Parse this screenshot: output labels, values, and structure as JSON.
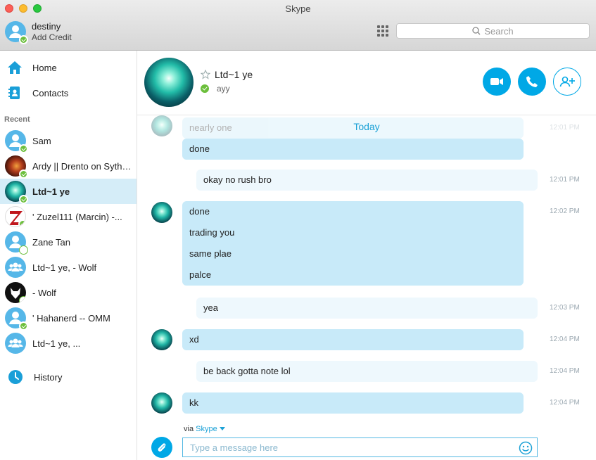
{
  "window": {
    "title": "Skype"
  },
  "profile": {
    "name": "destiny",
    "credit_label": "Add Credit"
  },
  "search": {
    "placeholder": "Search"
  },
  "nav": {
    "home": "Home",
    "contacts": "Contacts",
    "recent_heading": "Recent",
    "history": "History"
  },
  "contacts": [
    {
      "name": "Sam",
      "avatar": "default",
      "status": "online",
      "icon": "person-icon"
    },
    {
      "name": "Ardy || Drento on Sythe ||",
      "avatar": "photo-fire",
      "status": "online",
      "icon": "photo"
    },
    {
      "name": "Ltd~1 ye",
      "avatar": "photo-aurora",
      "status": "online",
      "icon": "photo",
      "active": true
    },
    {
      "name": "' Zuzel111 (Marcin) -...",
      "avatar": "photo-z",
      "status": "online",
      "icon": "photo"
    },
    {
      "name": "Zane Tan",
      "avatar": "default",
      "status": "away",
      "icon": "person-icon"
    },
    {
      "name": "Ltd~1 ye, - Wolf",
      "avatar": "group",
      "status": "none",
      "icon": "group-icon"
    },
    {
      "name": "- Wolf",
      "avatar": "photo-wolf",
      "status": "away",
      "icon": "photo"
    },
    {
      "name": "' Hahanerd -- OMM",
      "avatar": "default",
      "status": "online",
      "icon": "person-icon"
    },
    {
      "name": "Ltd~1 ye, ...",
      "avatar": "group",
      "status": "none",
      "icon": "group-icon"
    }
  ],
  "conversation": {
    "name": "Ltd~1 ye",
    "mood": "ayy",
    "date_divider": "Today",
    "messages": [
      {
        "direction": "in",
        "lines": [
          "nearly one"
        ],
        "time": "12:01 PM",
        "faded": true
      },
      {
        "direction": "in",
        "lines": [
          "done"
        ],
        "time": ""
      },
      {
        "direction": "out",
        "lines": [
          "okay no rush bro"
        ],
        "time": "12:01 PM"
      },
      {
        "direction": "in",
        "lines": [
          "done",
          "trading you",
          "same plae",
          "palce"
        ],
        "time": "12:02 PM"
      },
      {
        "direction": "out",
        "lines": [
          "yea"
        ],
        "time": "12:03 PM"
      },
      {
        "direction": "in",
        "lines": [
          "xd"
        ],
        "time": "12:04 PM"
      },
      {
        "direction": "out",
        "lines": [
          "be back gotta note lol"
        ],
        "time": "12:04 PM"
      },
      {
        "direction": "in",
        "lines": [
          "kk"
        ],
        "time": "12:04 PM"
      }
    ]
  },
  "composer": {
    "via_label": "via",
    "via_service": "Skype",
    "placeholder": "Type a message here"
  },
  "colors": {
    "accent": "#00a8e6",
    "online": "#6cbf3c",
    "bubble_in": "#c8eaf9",
    "bubble_out": "#eef8fd",
    "selected": "#d5edf8"
  }
}
